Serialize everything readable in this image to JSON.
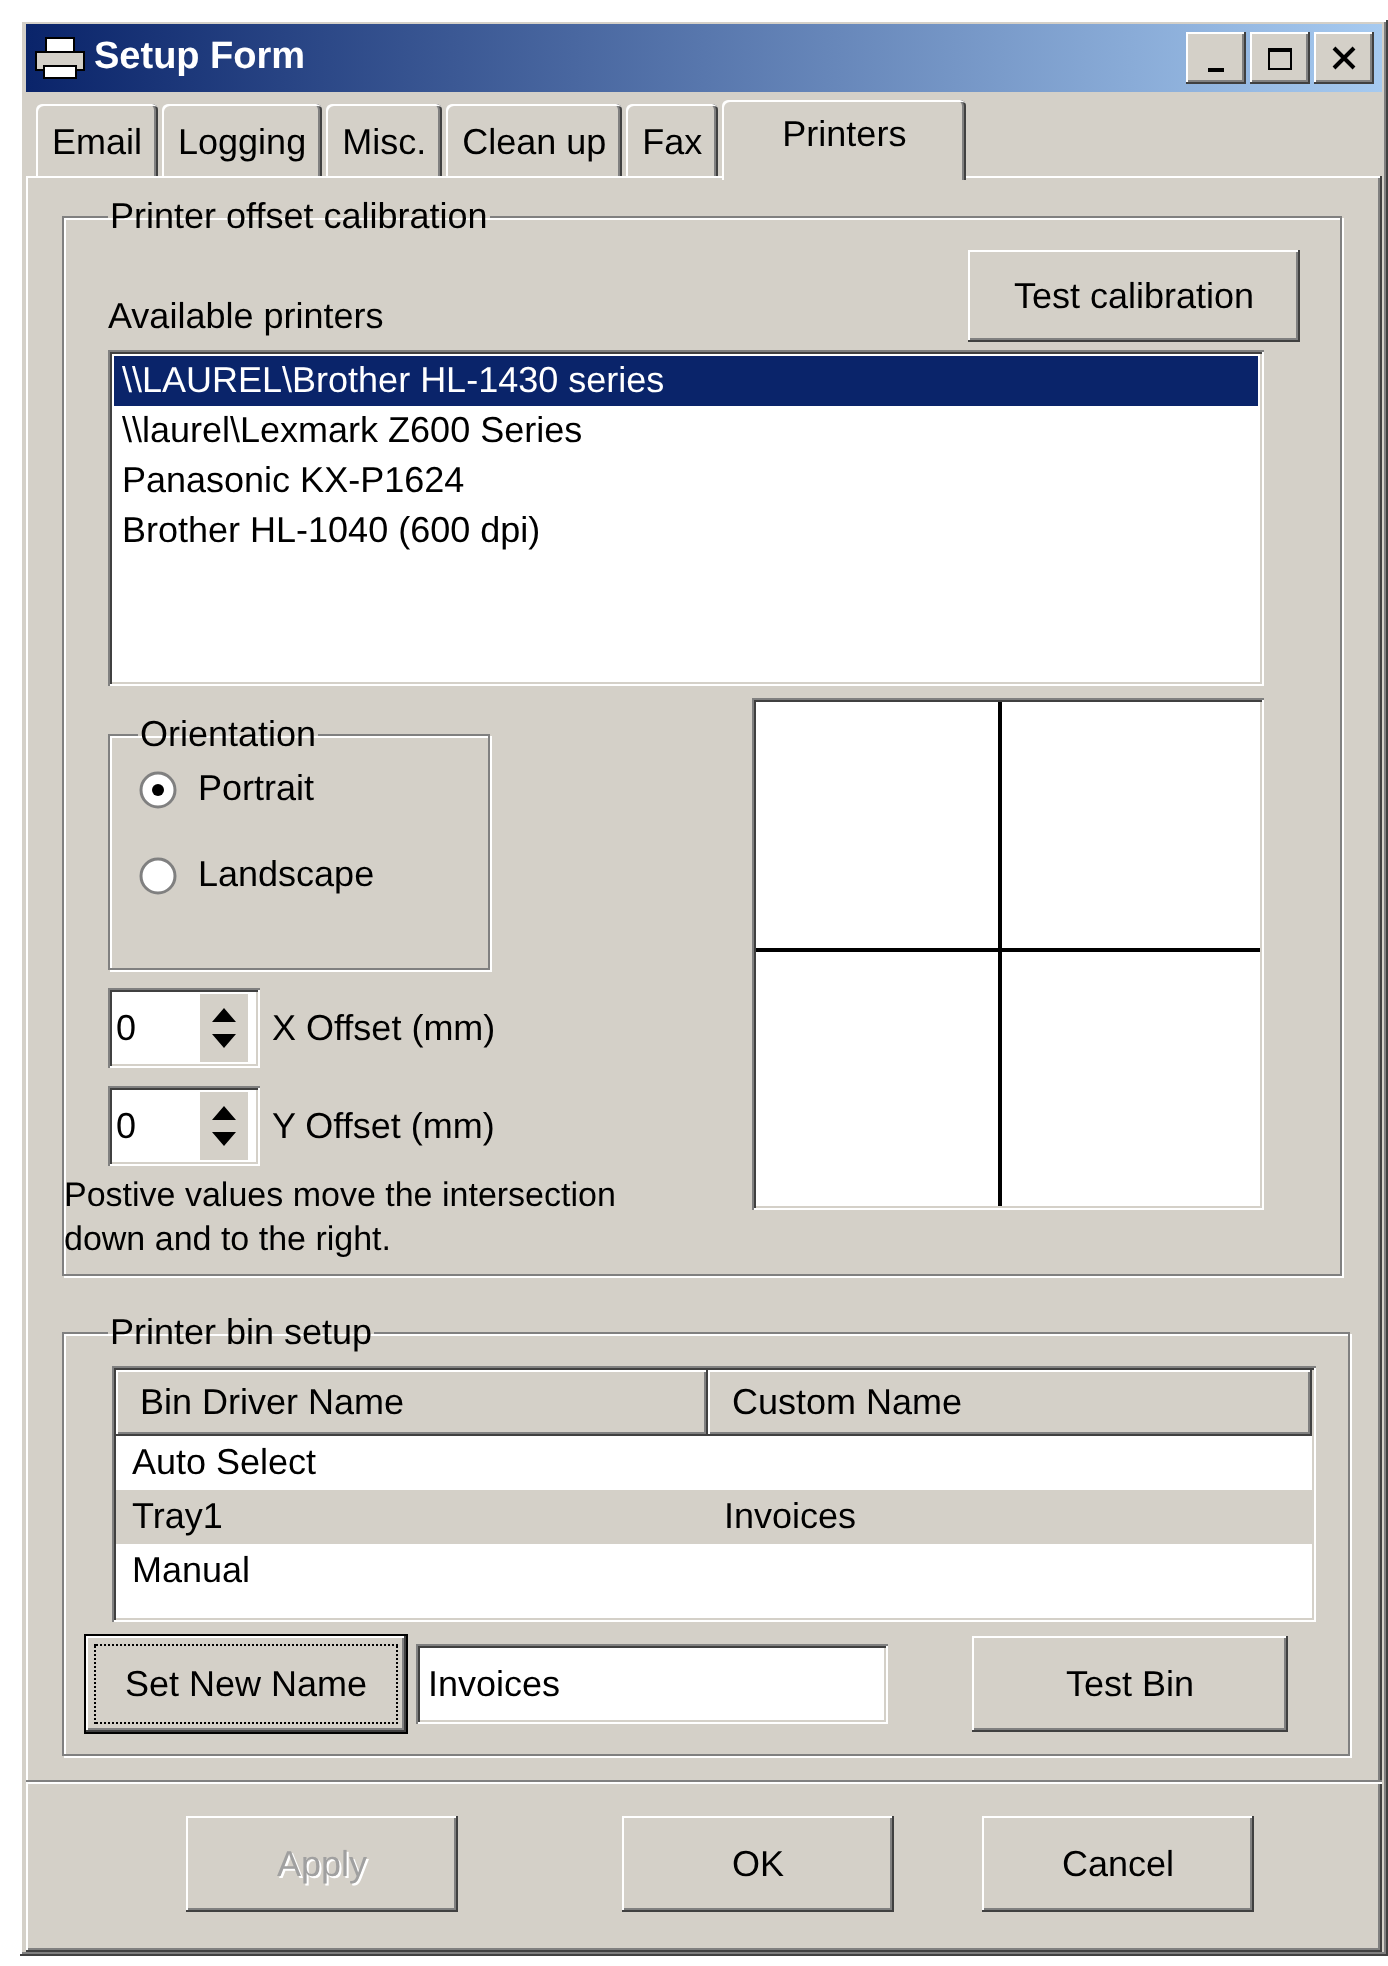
{
  "window": {
    "title": "Setup Form"
  },
  "tabs": [
    {
      "label": "Email",
      "selected": false
    },
    {
      "label": "Logging",
      "selected": false
    },
    {
      "label": "Misc.",
      "selected": false
    },
    {
      "label": "Clean up",
      "selected": false
    },
    {
      "label": "Fax",
      "selected": false
    },
    {
      "label": "Printers",
      "selected": true
    }
  ],
  "calibration": {
    "title": "Printer offset calibration",
    "test_button": "Test calibration",
    "printers_label": "Available printers",
    "printers": [
      {
        "name": "\\\\LAUREL\\Brother HL-1430 series",
        "selected": true
      },
      {
        "name": "\\\\laurel\\Lexmark Z600 Series",
        "selected": false
      },
      {
        "name": "Panasonic KX-P1624",
        "selected": false
      },
      {
        "name": "Brother HL-1040 (600 dpi)",
        "selected": false
      }
    ],
    "orientation": {
      "title": "Orientation",
      "options": [
        {
          "label": "Portrait",
          "selected": true
        },
        {
          "label": "Landscape",
          "selected": false
        }
      ]
    },
    "offsets": [
      {
        "value": "0",
        "label": "X Offset (mm)"
      },
      {
        "value": "0",
        "label": "Y Offset (mm)"
      }
    ],
    "note": "Postive values move the intersection down and to the right."
  },
  "bins": {
    "title": "Printer bin setup",
    "columns": [
      "Bin Driver Name",
      "Custom Name"
    ],
    "rows": [
      {
        "driver": "Auto Select",
        "selected": false
      },
      {
        "driver": "Tray1",
        "custom": "Invoices",
        "selected": true
      },
      {
        "driver": "Manual",
        "selected": false
      }
    ],
    "set_name_button": {
      "label": "Set New Name",
      "focused": true
    },
    "name_value": "Invoices",
    "test_button": "Test Bin"
  },
  "buttons": [
    {
      "label": "Apply",
      "disabled": true
    },
    {
      "label": "OK",
      "disabled": false
    },
    {
      "label": "Cancel",
      "disabled": false
    }
  ]
}
